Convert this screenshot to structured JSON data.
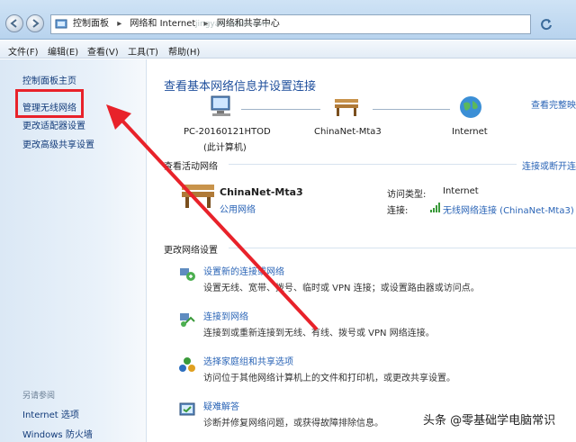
{
  "address": {
    "crumbs": [
      "控制面板",
      "网络和 Internet",
      "网络和共享中心"
    ],
    "url_overlay": "jingyan.baidu.com"
  },
  "menu": [
    "文件(F)",
    "编辑(E)",
    "查看(V)",
    "工具(T)",
    "帮助(H)"
  ],
  "sidebar": {
    "links": [
      "控制面板主页",
      "管理无线网络",
      "更改适配器设置",
      "更改高级共享设置"
    ],
    "see_also_label": "另请参阅",
    "see_also": [
      "Internet 选项",
      "Windows 防火墙"
    ]
  },
  "main": {
    "title": "查看基本网络信息并设置连接",
    "view_full_map": "查看完整映",
    "nodes": [
      {
        "label": "PC-20160121HTOD",
        "sub": "(此计算机)"
      },
      {
        "label": "ChinaNet-Mta3",
        "sub": ""
      },
      {
        "label": "Internet",
        "sub": ""
      }
    ],
    "active_label": "查看活动网络",
    "connect_disconnect": "连接或断开连",
    "network": {
      "name": "ChinaNet-Mta3",
      "type": "公用网络",
      "access_type_label": "访问类型:",
      "access_type_value": "Internet",
      "connection_label": "连接:",
      "connection_value": "无线网络连接 (ChinaNet-Mta3)"
    },
    "change_label": "更改网络设置",
    "tasks": [
      {
        "title": "设置新的连接或网络",
        "desc": "设置无线、宽带、拨号、临时或 VPN 连接；或设置路由器或访问点。",
        "icon": "new-connection-icon"
      },
      {
        "title": "连接到网络",
        "desc": "连接到或重新连接到无线、有线、拨号或 VPN 网络连接。",
        "icon": "connect-network-icon"
      },
      {
        "title": "选择家庭组和共享选项",
        "desc": "访问位于其他网络计算机上的文件和打印机，或更改共享设置。",
        "icon": "homegroup-icon"
      },
      {
        "title": "疑难解答",
        "desc": "诊断并修复网络问题，或获得故障排除信息。",
        "icon": "troubleshoot-icon"
      }
    ]
  },
  "watermark": "头条 @零基础学电脑常识",
  "colors": {
    "highlight": "#e8222a",
    "link": "#2a64b6"
  }
}
